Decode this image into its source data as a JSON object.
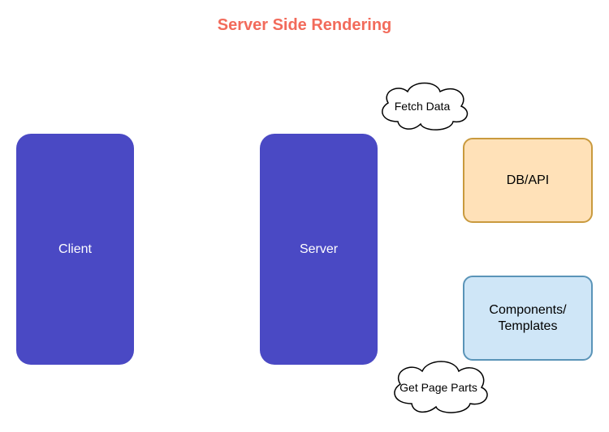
{
  "title": "Server Side Rendering",
  "nodes": {
    "client": "Client",
    "server": "Server",
    "dbapi": "DB/API",
    "components": "Components/\nTemplates"
  },
  "clouds": {
    "fetch": "Fetch Data",
    "getparts": "Get Page Parts"
  },
  "colors": {
    "title": "#f26b5b",
    "panel_primary": "#4a49c4",
    "dbapi_fill": "#ffe1b8",
    "dbapi_stroke": "#c99a3e",
    "components_fill": "#cfe6f7",
    "components_stroke": "#5a94b8"
  }
}
